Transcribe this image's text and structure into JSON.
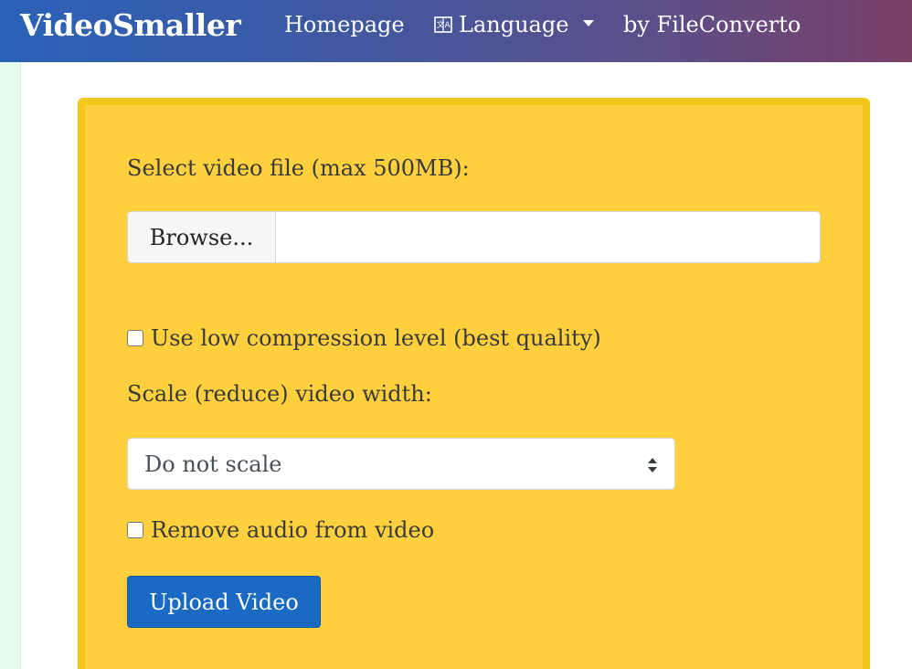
{
  "navbar": {
    "brand": "VideoSmaller",
    "homepage": "Homepage",
    "language": "Language",
    "by": "by FileConverto"
  },
  "form": {
    "select_label": "Select video file (max 500MB):",
    "browse_label": "Browse...",
    "file_name": "",
    "low_compression_label": "Use low compression level (best quality)",
    "low_compression_checked": false,
    "scale_label": "Scale (reduce) video width:",
    "scale_selected": "Do not scale",
    "remove_audio_label": "Remove audio from video",
    "remove_audio_checked": false,
    "upload_label": "Upload Video"
  },
  "colors": {
    "card_bg": "#fed03e",
    "card_border": "#f3c61b",
    "upload_button": "#1a6ac4",
    "left_strip": "#e3fbea"
  },
  "icons": {
    "language": "language-icon",
    "dropdown": "caret-down-icon",
    "select": "select-arrows-icon"
  }
}
